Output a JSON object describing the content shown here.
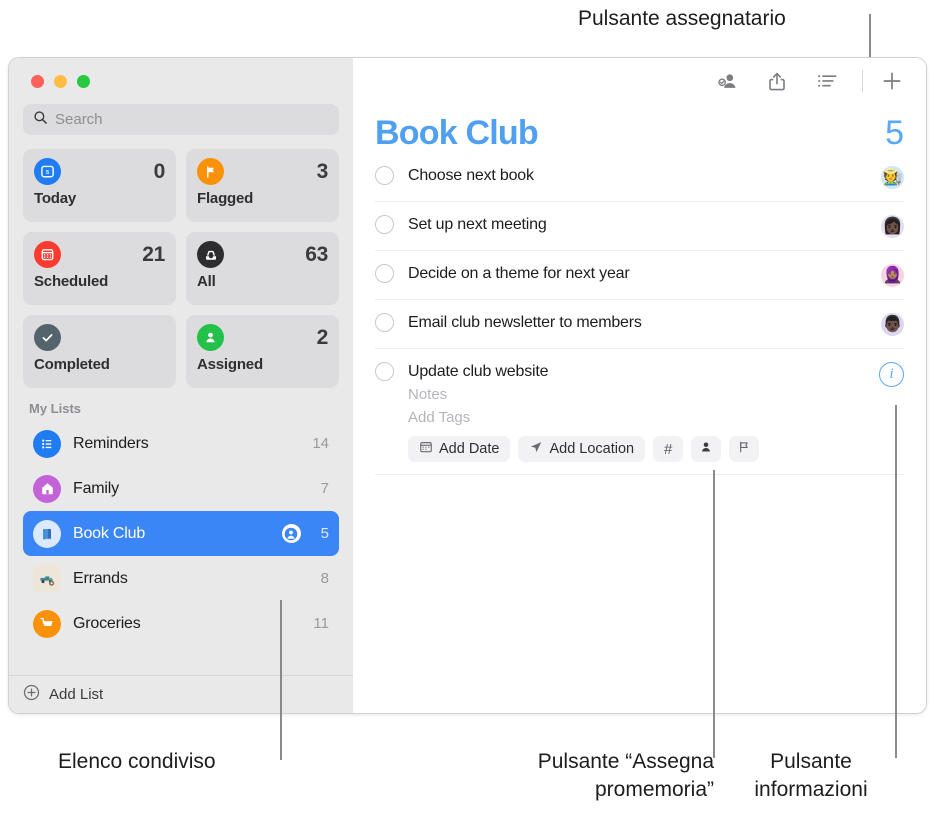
{
  "callouts": {
    "assignee_button": "Pulsante assegnatario",
    "shared_list": "Elenco condiviso",
    "assign_reminder_button": "Pulsante “Assegna\npromemoria”",
    "info_button": "Pulsante\ninformazioni"
  },
  "window": {
    "traffic_lights": [
      "close",
      "minimize",
      "zoom"
    ]
  },
  "sidebar": {
    "search": {
      "placeholder": "Search",
      "value": "",
      "icon": "search-icon"
    },
    "smart_lists": [
      {
        "label": "Today",
        "count": "0",
        "icon": "today-calendar-icon",
        "color": "#1f7cf2"
      },
      {
        "label": "Flagged",
        "count": "3",
        "icon": "flag-icon",
        "color": "#f99209"
      },
      {
        "label": "Scheduled",
        "count": "21",
        "icon": "calendar-icon",
        "color": "#fc3b30"
      },
      {
        "label": "All",
        "count": "63",
        "icon": "inbox-tray-icon",
        "color": "#2d2d30"
      },
      {
        "label": "Completed",
        "count": "",
        "icon": "checkmark-icon",
        "color": "#54646d"
      },
      {
        "label": "Assigned",
        "count": "2",
        "icon": "person-icon",
        "color": "#23c14a"
      }
    ],
    "section_title": "My Lists",
    "lists": [
      {
        "name": "Reminders",
        "count": "14",
        "icon": "bullet-list-icon",
        "color": "#1f7cf2",
        "selected": false,
        "shared": false
      },
      {
        "name": "Family",
        "count": "7",
        "icon": "house-icon",
        "color": "#c462d8",
        "selected": false,
        "shared": false
      },
      {
        "name": "Book Club",
        "count": "5",
        "icon": "book-icon",
        "color": "#dbeaff",
        "selected": true,
        "shared": true
      },
      {
        "name": "Errands",
        "count": "8",
        "icon": "truck-icon",
        "color": "#eee6d9",
        "selected": false,
        "shared": false
      },
      {
        "name": "Groceries",
        "count": "11",
        "icon": "cart-icon",
        "color": "#f99209",
        "selected": false,
        "shared": false
      }
    ],
    "add_list": {
      "label": "Add List",
      "icon": "plus-circle-icon"
    }
  },
  "main": {
    "toolbar": [
      {
        "name": "assignee-button",
        "icon": "person-badge-check-icon"
      },
      {
        "name": "share-button",
        "icon": "share-icon"
      },
      {
        "name": "view-options-button",
        "icon": "list-view-icon"
      },
      {
        "name": "add-reminder-button",
        "icon": "plus-icon"
      }
    ],
    "title": "Book Club",
    "count": "5",
    "accent_color": "#4fa0f0",
    "tasks": [
      {
        "text": "Choose next book",
        "avatar": "🧑‍🌾",
        "avatar_bg": "#cfe7f7",
        "expanded": false
      },
      {
        "text": "Set up next meeting",
        "avatar": "👩🏿",
        "avatar_bg": "#e6dcf5",
        "expanded": false
      },
      {
        "text": "Decide on a theme for next year",
        "avatar": "🧕🏽",
        "avatar_bg": "#f7d3e2",
        "expanded": false
      },
      {
        "text": "Email club newsletter to members",
        "avatar": "👨🏿",
        "avatar_bg": "#ddd6f3",
        "expanded": false
      },
      {
        "text": "Update club website",
        "avatar": "",
        "avatar_bg": "",
        "expanded": true
      }
    ],
    "detail": {
      "notes_placeholder": "Notes",
      "tags_placeholder": "Add Tags",
      "buttons": [
        {
          "label": "Add Date",
          "icon": "calendar-icon"
        },
        {
          "label": "Add Location",
          "icon": "location-arrow-icon"
        },
        {
          "label": "#",
          "icon": "hash-icon"
        },
        {
          "label": "",
          "icon": "assign-person-icon"
        },
        {
          "label": "",
          "icon": "flag-outline-icon"
        }
      ],
      "info_icon": "info-icon"
    }
  }
}
